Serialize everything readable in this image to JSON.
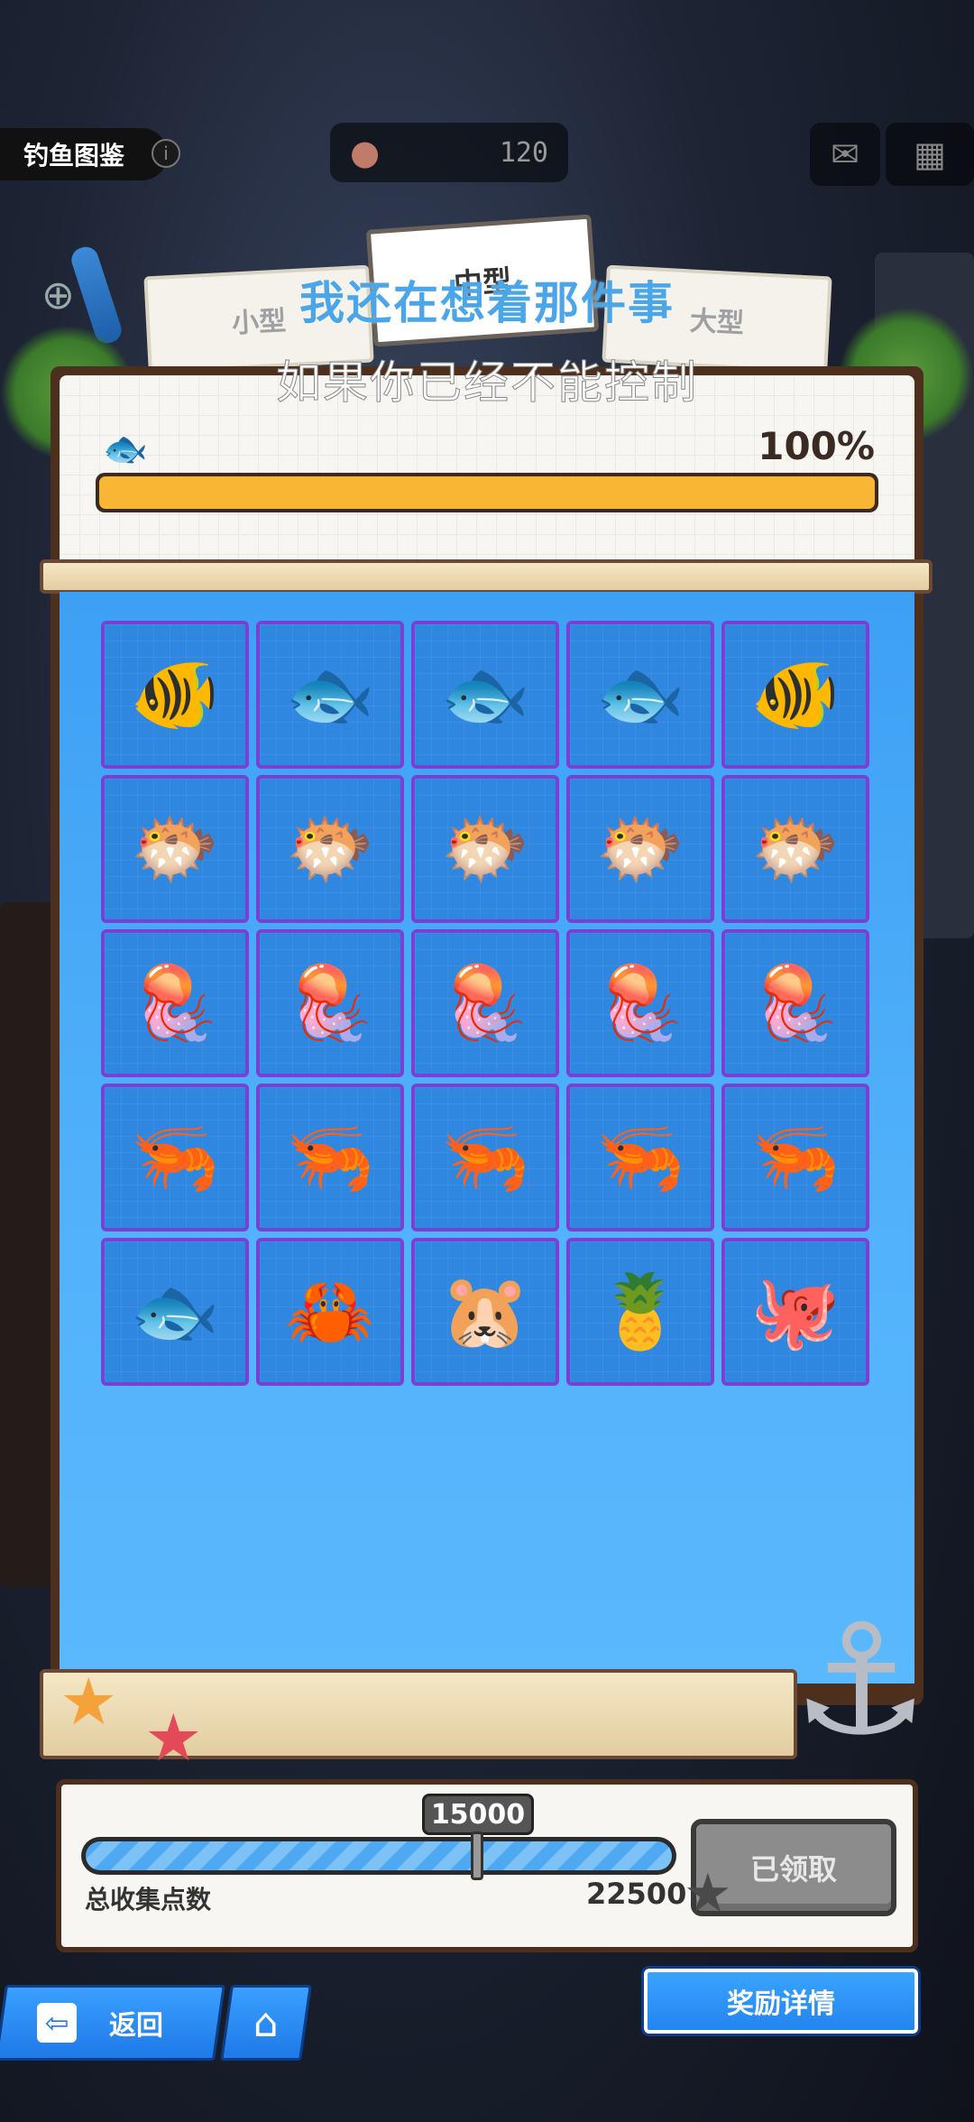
{
  "header": {
    "title": "钓鱼图鉴",
    "info_icon": "info-icon",
    "currency_icon": "bait-icon",
    "currency_value": "120",
    "mail_icon": "mail-icon",
    "menu_icon": "grid-menu-icon"
  },
  "tabs": [
    {
      "label": "小型",
      "selected": false
    },
    {
      "label": "中型",
      "selected": true
    },
    {
      "label": "大型",
      "selected": false
    }
  ],
  "subtitles": {
    "line1": "我还在想着那件事",
    "line2": "如果你已经不能控制"
  },
  "collection": {
    "icon": "fish-icon",
    "percent_label": "100%",
    "progress": 1.0
  },
  "fish_grid": [
    {
      "name": "pink-fish",
      "glyph": "🐠"
    },
    {
      "name": "cyan-fish",
      "glyph": "🐟"
    },
    {
      "name": "green-fish",
      "glyph": "🐟"
    },
    {
      "name": "dark-blue-fish",
      "glyph": "🐟"
    },
    {
      "name": "orange-fish",
      "glyph": "🐠"
    },
    {
      "name": "black-pufferfish",
      "glyph": "🐡"
    },
    {
      "name": "yellow-pufferfish",
      "glyph": "🐡"
    },
    {
      "name": "white-pufferfish",
      "glyph": "🐡"
    },
    {
      "name": "spotted-pufferfish",
      "glyph": "🐡"
    },
    {
      "name": "brown-pufferfish",
      "glyph": "🐡"
    },
    {
      "name": "blue-jellyfish",
      "glyph": "🪼"
    },
    {
      "name": "cream-jellyfish",
      "glyph": "🪼"
    },
    {
      "name": "light-blue-jellyfish",
      "glyph": "🪼"
    },
    {
      "name": "pink-jellyfish",
      "glyph": "🪼"
    },
    {
      "name": "purple-jellyfish",
      "glyph": "🪼"
    },
    {
      "name": "blue-shrimp",
      "glyph": "🦐"
    },
    {
      "name": "red-white-shrimp",
      "glyph": "🦐"
    },
    {
      "name": "red-shrimp",
      "glyph": "🦐"
    },
    {
      "name": "brown-shrimp",
      "glyph": "🦐"
    },
    {
      "name": "orange-shrimp",
      "glyph": "🦐"
    },
    {
      "name": "anglerfish",
      "glyph": "🐟"
    },
    {
      "name": "warrior-crab",
      "glyph": "🦀"
    },
    {
      "name": "hamster-bubble",
      "glyph": "🐹"
    },
    {
      "name": "pineapple",
      "glyph": "🍍"
    },
    {
      "name": "pirate-octopus",
      "glyph": "🐙"
    }
  ],
  "points": {
    "current_badge": "15000",
    "total_label": "总收集点数",
    "total_value": "22500",
    "current": 15000,
    "max": 22500,
    "claim_label": "已领取"
  },
  "footer": {
    "back_label": "返回",
    "back_icon": "exit-icon",
    "home_icon": "home-icon",
    "reward_label": "奖励详情"
  },
  "colors": {
    "grid_bg": "#4aa8f8",
    "cell_border": "#7b3fd6",
    "progress": "#f8b634",
    "button_blue": "#2384ef"
  }
}
